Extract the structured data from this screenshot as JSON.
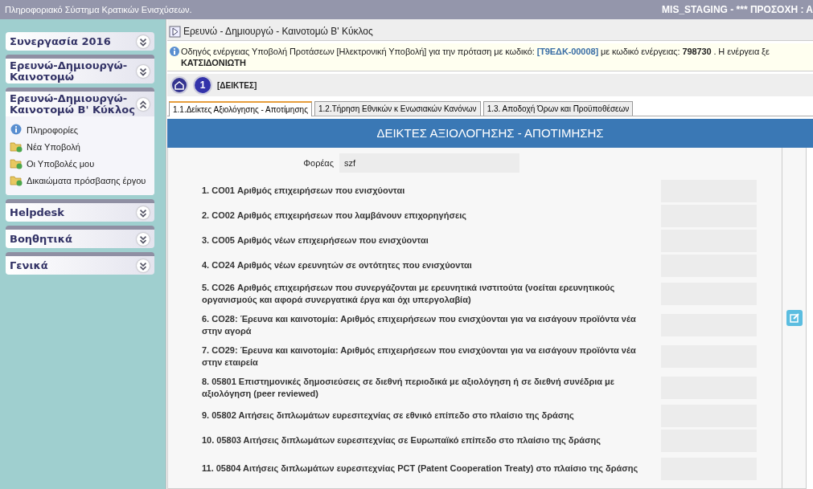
{
  "top_bar": {
    "title": "Πληροφοριακό Σύστημα Κρατικών Ενισχύσεων.",
    "notice": "MIS_STAGING - *** ΠΡΟΣΟΧΗ : Α"
  },
  "sidebar": {
    "sections": [
      {
        "label": "Συνεργασία 2016",
        "expanded": false
      },
      {
        "label": "Ερευνώ-Δημιουργώ-Καινοτομώ",
        "expanded": false
      },
      {
        "label": "Ερευνώ-Δημιουργώ-Καινοτομώ Β' Κύκλος",
        "expanded": true,
        "items": [
          {
            "label": "Πληροφορίες",
            "kind": "info"
          },
          {
            "label": "Νέα Υποβολή",
            "kind": "folder"
          },
          {
            "label": "Οι Υποβολές μου",
            "kind": "folder"
          },
          {
            "label": "Δικαιώματα πρόσβασης έργου",
            "kind": "folder"
          }
        ]
      },
      {
        "label": "Helpdesk",
        "expanded": false
      },
      {
        "label": "Βοηθητικά",
        "expanded": false
      },
      {
        "label": "Γενικά",
        "expanded": false
      }
    ]
  },
  "breadcrumb": "Ερευνώ - Δημιουργώ - Καινοτομώ Β' Κύκλος",
  "info_message": {
    "lines": [
      [
        {
          "text": "Οδηγός ενέργειας Υποβολή Προτάσεων [Ηλεκτρονική Υποβολή] για την πρόταση με κωδικό: ",
          "kind": "plain"
        },
        {
          "text": "[Τ9ΕΔΚ-00008]",
          "kind": "code"
        },
        {
          "text": " με κωδικό ενέργειας: ",
          "kind": "plain"
        },
        {
          "text": "798730",
          "kind": "bold"
        },
        {
          "text": " . Η ενέργεια ξε",
          "kind": "plain"
        }
      ],
      [
        {
          "text": "ΚΑΤΣΙΔΟΝΙΩΤΗ",
          "kind": "bold"
        }
      ]
    ]
  },
  "steps": {
    "number": "1",
    "label": "[ΔΕΙΚΤΕΣ]"
  },
  "tabs": [
    {
      "label": "1.1.Δείκτες Αξιολόγησης - Αποτίμησης",
      "selected": true
    },
    {
      "label": "1.2.Τήρηση Εθνικών κ Ενωσιακών Κανόνων",
      "selected": false
    },
    {
      "label": "1.3. Αποδοχή Όρων και Προϋποθέσεων",
      "selected": false
    }
  ],
  "form": {
    "title": "ΔΕΙΚΤΕΣ ΑΞΙΟΛΟΓΗΣΗΣ - ΑΠΟΤΙΜΗΣΗΣ",
    "organization": {
      "label": "Φορέας",
      "value": "szf"
    },
    "indicators": [
      "1. CO01 Αριθμός επιχειρήσεων που ενισχύονται",
      "2. CO02 Αριθμός επιχειρήσεων που λαμβάνουν επιχορηγήσεις",
      "3. CO05 Αριθμός νέων επιχειρήσεων που ενισχύονται",
      "4. CO24 Αριθμός νέων ερευνητών σε οντότητες που ενισχύονται",
      "5. CO26 Αριθμός επιχειρήσεων που συνεργάζονται με ερευνητικά ινστιτούτα (νοείται ερευνητικούς οργανισμούς και αφορά συνεργατικά έργα και όχι υπεργολαβία)",
      "6. CO28: Έρευνα και καινοτομία: Αριθμός επιχειρήσεων που ενισχύονται για να εισάγουν προϊόντα νέα στην αγορά",
      "7. CO29: Έρευνα και καινοτομία: Αριθμός επιχειρήσεων που ενισχύονται για να εισάγουν προϊόντα νέα στην εταιρεία",
      "8. 05801 Επιστημονικές δημοσιεύσεις σε διεθνή περιοδικά με αξιολόγηση ή σε διεθνή συνέδρια με αξιολόγηση (peer reviewed)",
      "9. 05802 Αιτήσεις διπλωμάτων ευρεσιτεχνίας σε εθνικό επίπεδο στο πλαίσιο της δράσης",
      "10. 05803 Αιτήσεις διπλωμάτων ευρεσιτεχνίας σε Ευρωπαϊκό επίπεδο στο πλαίσιο της δράσης",
      "11. 05804 Αιτήσεις διπλωμάτων ευρεσιτεχνίας PCT (Patent Cooperation Treaty) στο πλαίσιο της δράσης"
    ]
  }
}
